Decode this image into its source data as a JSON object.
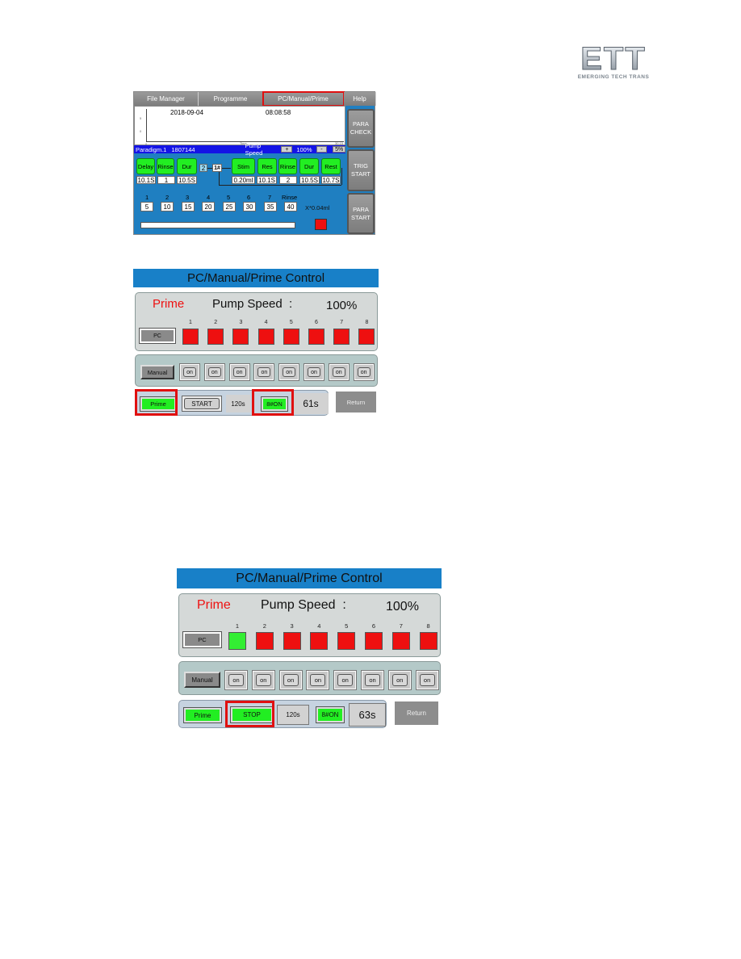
{
  "logo": {
    "main": "ETT",
    "sub": "EMERGING TECH TRANS"
  },
  "screen1": {
    "tabs": [
      "File Manager",
      "Programme",
      "PC/Manual/Prime",
      "Help"
    ],
    "highlighted_tab": "PC/Manual/Prime",
    "chart": {
      "date": "2018-09-04",
      "time": "08:08:58",
      "x_label": "Time",
      "y_ticks": [
        "5",
        "0"
      ],
      "x_ticks": [
        "0",
        "30.15"
      ]
    },
    "status": {
      "paradigm": "Paradigm.1",
      "id": "1807144",
      "pump_speed_label": "Pump Speed",
      "plus": "+",
      "speed": "100%",
      "minus": "-",
      "step": "5%"
    },
    "side_buttons": [
      "PARA\nCHECK",
      "TRIG\nSTART",
      "PARA\nSTART"
    ],
    "side_buttons_lines": [
      [
        "PARA",
        "CHECK"
      ],
      [
        "TRIG",
        "START"
      ],
      [
        "PARA",
        "START"
      ]
    ],
    "left_steps": [
      {
        "label": "Delay",
        "value": "10.1S"
      },
      {
        "label": "Rinse",
        "value": "1"
      },
      {
        "label": "Dur",
        "value": "10.5S"
      }
    ],
    "loop_count": "2",
    "channel": "1#",
    "right_steps": [
      {
        "label": "Stim",
        "value": "0.20ml"
      },
      {
        "label": "Res",
        "value": "10.1S"
      },
      {
        "label": "Rinse",
        "value": "2"
      },
      {
        "label": "Dur",
        "value": "10.5S"
      },
      {
        "label": "Rest",
        "value": "10.7S"
      }
    ],
    "volumes": [
      {
        "label": "1",
        "value": "5"
      },
      {
        "label": "2",
        "value": "10"
      },
      {
        "label": "3",
        "value": "15"
      },
      {
        "label": "4",
        "value": "20"
      },
      {
        "label": "5",
        "value": "25"
      },
      {
        "label": "6",
        "value": "30"
      },
      {
        "label": "7",
        "value": "35"
      },
      {
        "label": "Rinse",
        "value": "40"
      }
    ],
    "unit": "X*0.04ml",
    "progress": 0,
    "indicator_color": "#ee1010"
  },
  "control1": {
    "title": "PC/Manual/Prime Control",
    "mode": "Prime",
    "pump_speed_label": "Pump Speed  :",
    "pump_speed": "100%",
    "pc_label": "PC",
    "channels": [
      {
        "num": "1",
        "state": "off"
      },
      {
        "num": "2",
        "state": "off"
      },
      {
        "num": "3",
        "state": "off"
      },
      {
        "num": "4",
        "state": "off"
      },
      {
        "num": "5",
        "state": "off"
      },
      {
        "num": "6",
        "state": "off"
      },
      {
        "num": "7",
        "state": "off"
      },
      {
        "num": "8",
        "state": "off"
      }
    ],
    "manual_label": "Manual",
    "on_labels": [
      "on",
      "on",
      "on",
      "on",
      "on",
      "on",
      "on",
      "on"
    ],
    "prime_btn": "Prime",
    "start_btn": "START",
    "duration": "120s",
    "all_on_btn": "8#ON",
    "elapsed": "61s",
    "return_btn": "Return"
  },
  "control2": {
    "title": "PC/Manual/Prime Control",
    "mode": "Prime",
    "pump_speed_label": "Pump Speed  :",
    "pump_speed": "100%",
    "pc_label": "PC",
    "channels": [
      {
        "num": "1",
        "state": "on"
      },
      {
        "num": "2",
        "state": "off"
      },
      {
        "num": "3",
        "state": "off"
      },
      {
        "num": "4",
        "state": "off"
      },
      {
        "num": "5",
        "state": "off"
      },
      {
        "num": "6",
        "state": "off"
      },
      {
        "num": "7",
        "state": "off"
      },
      {
        "num": "8",
        "state": "off"
      }
    ],
    "manual_label": "Manual",
    "on_labels": [
      "on",
      "on",
      "on",
      "on",
      "on",
      "on",
      "on",
      "on"
    ],
    "prime_btn": "Prime",
    "stop_btn": "STOP",
    "duration": "120s",
    "all_on_btn": "8#ON",
    "elapsed": "63s",
    "return_btn": "Return"
  },
  "colors": {
    "accent_blue": "#1880c8",
    "status_blue": "#1414e6",
    "active_green": "#22ee22",
    "inactive_red": "#ee1010",
    "highlight_red": "#e01010"
  }
}
